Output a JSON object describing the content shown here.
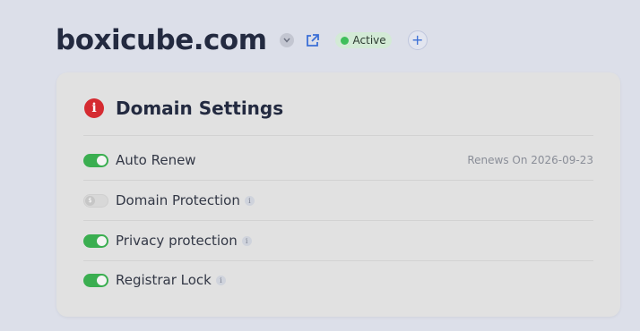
{
  "header": {
    "domain": "boxicube.com",
    "status": "Active",
    "add_label": "+",
    "icons": {
      "dropdown": "chevron-down-icon",
      "external": "external-link-icon"
    }
  },
  "domain_settings": {
    "title": "Domain Settings",
    "title_icon": "i",
    "settings": [
      {
        "label": "Auto Renew",
        "enabled": true,
        "note": "Renews On 2026-09-23"
      },
      {
        "label": "Domain Protection",
        "enabled": false,
        "info": "i"
      },
      {
        "label": "Privacy protection",
        "enabled": true,
        "info": "i"
      },
      {
        "label": "Registrar Lock",
        "enabled": true,
        "info": "i"
      }
    ]
  },
  "colors": {
    "accent": "#3b6fd6",
    "toggle_on": "#3aae50",
    "status_green": "#3fbf5a",
    "danger": "#d52b31"
  }
}
